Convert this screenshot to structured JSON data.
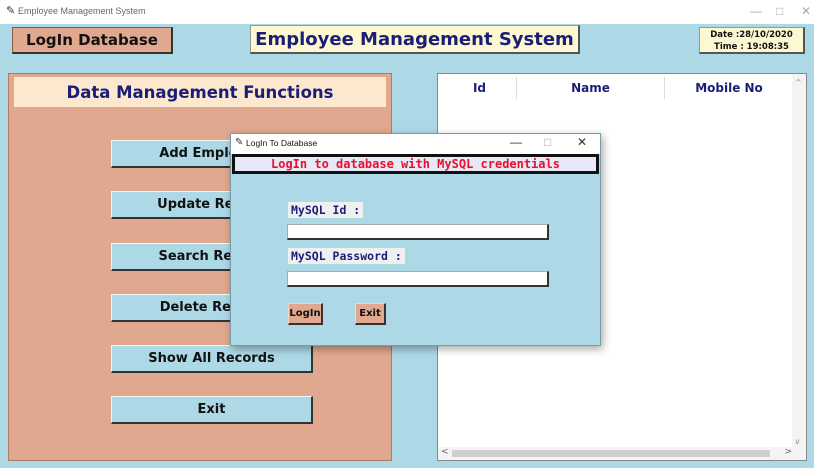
{
  "window": {
    "title": "Employee Management System",
    "controls": {
      "minimize": "—",
      "maximize": "□",
      "close": "✕"
    }
  },
  "header": {
    "login_button": "LogIn Database",
    "app_title": "Employee Management System",
    "date_line": "Date :28/10/2020",
    "time_line": "Time : 19:08:35"
  },
  "left_panel": {
    "title": "Data Management Functions",
    "buttons": [
      "Add Employee",
      "Update Record",
      "Search Record",
      "Delete Record",
      "Show All Records",
      "Exit"
    ]
  },
  "table": {
    "columns": [
      "Id",
      "Name",
      "Mobile No"
    ],
    "rows": []
  },
  "dialog": {
    "title": "LogIn To Database",
    "controls": {
      "minimize": "—",
      "maximize": "□",
      "close": "✕"
    },
    "header": "LogIn to database with MySQL credentials",
    "id_label": "MySQL Id :",
    "id_value": "",
    "password_label": "MySQL Password :",
    "password_value": "",
    "login_button": "LogIn",
    "exit_button": "Exit"
  },
  "colors": {
    "background": "#add8e6",
    "accent_salmon": "#dfa88f",
    "title_text": "#1b1e76",
    "dialog_header_text": "#e8102a",
    "panel_header_bg": "#fbe8cf",
    "title_bg": "#fdf8d2"
  },
  "icons": {
    "app_icon": "feather-icon",
    "scroll_up": "chevron-up-icon",
    "scroll_down": "chevron-down-icon",
    "scroll_left": "chevron-left-icon",
    "scroll_right": "chevron-right-icon"
  }
}
